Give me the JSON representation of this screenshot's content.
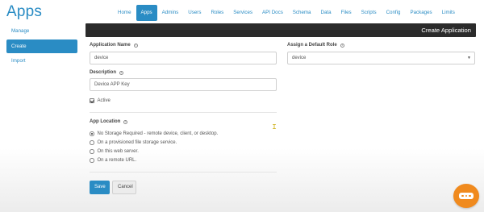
{
  "app": {
    "title": "Apps"
  },
  "topnav": {
    "items": [
      "Home",
      "Apps",
      "Admins",
      "Users",
      "Roles",
      "Services",
      "API Docs",
      "Schema",
      "Data",
      "Files",
      "Scripts",
      "Config",
      "Packages",
      "Limits"
    ],
    "active": "Apps"
  },
  "sidebar": {
    "items": [
      "Manage",
      "Create",
      "Import"
    ],
    "active": "Create"
  },
  "panel": {
    "title": "Create Application"
  },
  "form": {
    "app_name": {
      "label": "Application Name",
      "value": "device"
    },
    "default_role": {
      "label": "Assign a Default Role",
      "value": "device"
    },
    "description": {
      "label": "Description",
      "value": "Device APP Key"
    },
    "active": {
      "label": "Active",
      "checked": true
    },
    "location": {
      "label": "App Location",
      "options": [
        "No Storage Required - remote device, client, or desktop.",
        "On a provisioned file storage service.",
        "On this web server.",
        "On a remote URL."
      ],
      "selected_index": 0
    }
  },
  "buttons": {
    "save": "Save",
    "cancel": "Cancel"
  },
  "icons": {
    "info": "info-icon",
    "chat": "chat-icon",
    "cursor": "text-cursor-icon",
    "caret": "caret-down-icon"
  },
  "colors": {
    "accent": "#2a8cc4",
    "panel_bar": "#2b2b2b",
    "chat": "#f08a1e"
  }
}
